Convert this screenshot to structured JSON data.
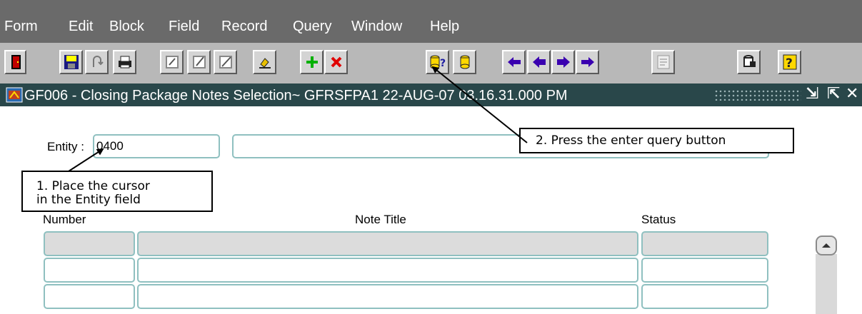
{
  "menu": {
    "form": "Form",
    "edit": "Edit",
    "block": "Block",
    "field": "Field",
    "record": "Record",
    "query": "Query",
    "window": "Window",
    "help": "Help"
  },
  "toolbar": {
    "buttons": [
      "exit-icon",
      "save-icon",
      "action-icon",
      "print-icon",
      "copy-icon",
      "paste-icon",
      "edit-icon",
      "clear-icon",
      "insert-record-icon",
      "delete-record-icon",
      "enter-query-icon",
      "execute-query-icon",
      "previous-block-icon",
      "previous-record-icon",
      "next-record-icon",
      "next-block-icon",
      "list-icon",
      "display-list-icon",
      "help-icon"
    ]
  },
  "window": {
    "title": "GF006 - Closing Package Notes Selection~ GFRSFPA1  22-AUG-07 03.16.31.000 PM",
    "controls": {
      "minimize": "⇲",
      "maximize": "⇱",
      "close": "✕"
    }
  },
  "form": {
    "entity_label": "Entity :",
    "entity_value": "0400",
    "entity_description": ""
  },
  "grid": {
    "headers": {
      "number": "Number",
      "note_title": "Note Title",
      "status": "Status"
    },
    "rows": [
      {
        "number": "",
        "note_title": "",
        "status": ""
      },
      {
        "number": "",
        "note_title": "",
        "status": ""
      },
      {
        "number": "",
        "note_title": "",
        "status": ""
      }
    ]
  },
  "callouts": {
    "step1_line1": "1. Place the cursor",
    "step1_line2": "in the Entity field",
    "step2": "2. Press the enter query button"
  },
  "colors": {
    "menubar": "#6a6a6a",
    "toolbar": "#b8b8b8",
    "titlebar": "#29474a",
    "field_border": "#8fc0c0"
  }
}
